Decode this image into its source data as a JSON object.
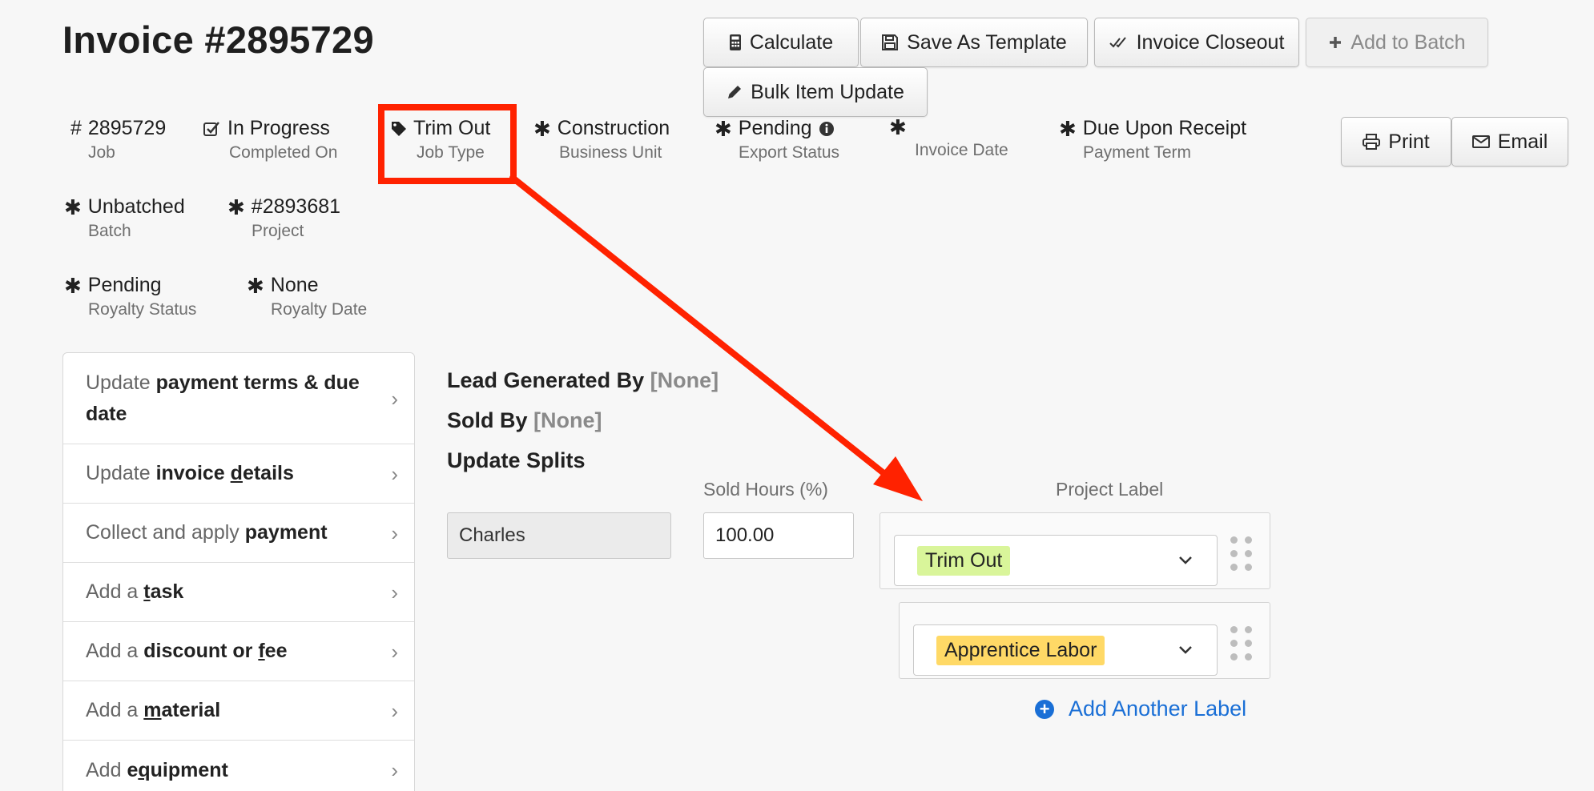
{
  "page": {
    "title": "Invoice #2895729"
  },
  "toolbar": {
    "calculate": "Calculate",
    "save_template": "Save As Template",
    "closeout": "Invoice Closeout",
    "add_batch": "Add to Batch",
    "bulk_update": "Bulk Item Update",
    "print": "Print",
    "email": "Email"
  },
  "meta": {
    "job": {
      "value": "2895729",
      "label": "Job"
    },
    "completed": {
      "value": "In Progress",
      "label": "Completed On"
    },
    "job_type": {
      "value": "Trim Out",
      "label": "Job Type"
    },
    "business_unit": {
      "value": "Construction",
      "label": "Business Unit"
    },
    "export_status": {
      "value": "Pending",
      "label": "Export Status"
    },
    "invoice_date": {
      "value": "",
      "label": "Invoice Date"
    },
    "payment_term": {
      "value": "Due Upon Receipt",
      "label": "Payment Term"
    },
    "batch": {
      "value": "Unbatched",
      "label": "Batch"
    },
    "project": {
      "value": "#2893681",
      "label": "Project"
    },
    "royalty_status": {
      "value": "Pending",
      "label": "Royalty Status"
    },
    "royalty_date": {
      "value": "None",
      "label": "Royalty Date"
    }
  },
  "menu": [
    {
      "pre": "Update ",
      "bold": "payment terms & due date"
    },
    {
      "pre": "Update ",
      "bold": "invoice details"
    },
    {
      "pre": "Collect and apply ",
      "bold": "payment"
    },
    {
      "pre": "Add a ",
      "bold": "task"
    },
    {
      "pre": "Add a ",
      "bold": "discount or fee"
    },
    {
      "pre": "Add a ",
      "bold": "material"
    },
    {
      "pre": "Add ",
      "bold": "equipment"
    }
  ],
  "content": {
    "lead_label": "Lead Generated By",
    "lead_value": "[None]",
    "sold_label": "Sold By",
    "sold_value": "[None]",
    "splits_label": "Update Splits",
    "sold_hours_header": "Sold Hours (%)",
    "project_label_header": "Project Label",
    "technician": "Charles",
    "hours": "100.00",
    "labels": [
      {
        "text": "Trim Out",
        "color": "#d9f59a"
      },
      {
        "text": "Apprentice Labor",
        "color": "#ffd966"
      }
    ],
    "add_label": "Add Another Label"
  },
  "colors": {
    "highlight": "#ff2200",
    "link": "#1a6fd6"
  }
}
